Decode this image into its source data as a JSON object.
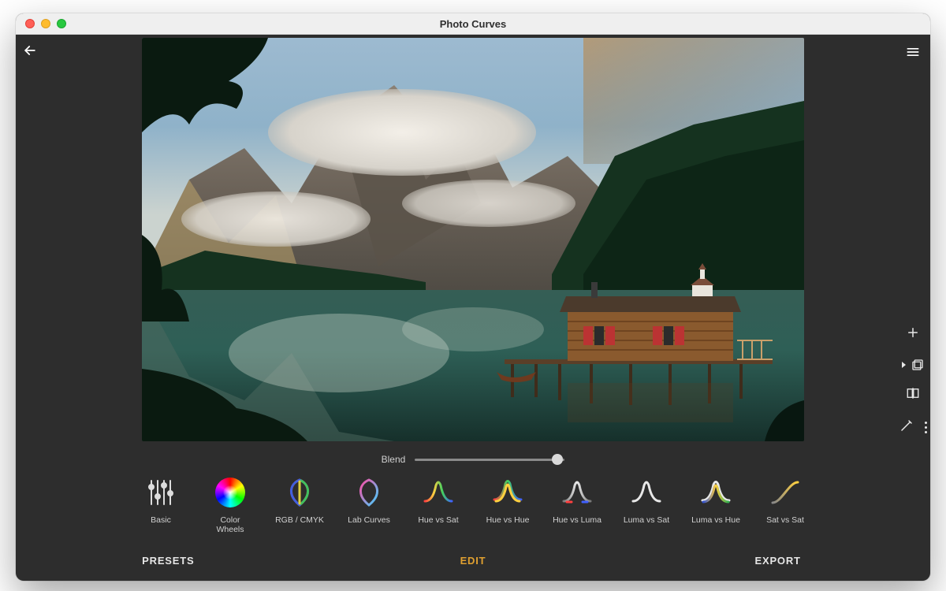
{
  "window": {
    "title": "Photo Curves"
  },
  "header": {
    "back_icon": "arrow-left",
    "menu_icon": "hamburger"
  },
  "blend": {
    "label": "Blend",
    "value_percent": 95
  },
  "tools": [
    {
      "id": "basic",
      "label": "Basic"
    },
    {
      "id": "color-wheels",
      "label": "Color Wheels"
    },
    {
      "id": "rgb-cmyk",
      "label": "RGB / CMYK"
    },
    {
      "id": "lab-curves",
      "label": "Lab Curves"
    },
    {
      "id": "hue-vs-sat",
      "label": "Hue vs Sat"
    },
    {
      "id": "hue-vs-hue",
      "label": "Hue vs Hue"
    },
    {
      "id": "hue-vs-luma",
      "label": "Hue vs Luma"
    },
    {
      "id": "luma-vs-sat",
      "label": "Luma vs Sat"
    },
    {
      "id": "luma-vs-hue",
      "label": "Luma vs Hue"
    },
    {
      "id": "sat-vs-sat",
      "label": "Sat vs Sat"
    }
  ],
  "tabs": {
    "presets": "PRESETS",
    "edit": "EDIT",
    "export": "EXPORT",
    "active": "edit"
  },
  "side_tools": {
    "add": "add-icon",
    "layers": "layers-icon",
    "compare": "compare-icon",
    "tweak": "tweak-icon",
    "more": "more-icon"
  },
  "image": {
    "description": "Alpine lake with mountains, low clouds, forest, wooden boathouse on stilts, small church on far shore"
  }
}
